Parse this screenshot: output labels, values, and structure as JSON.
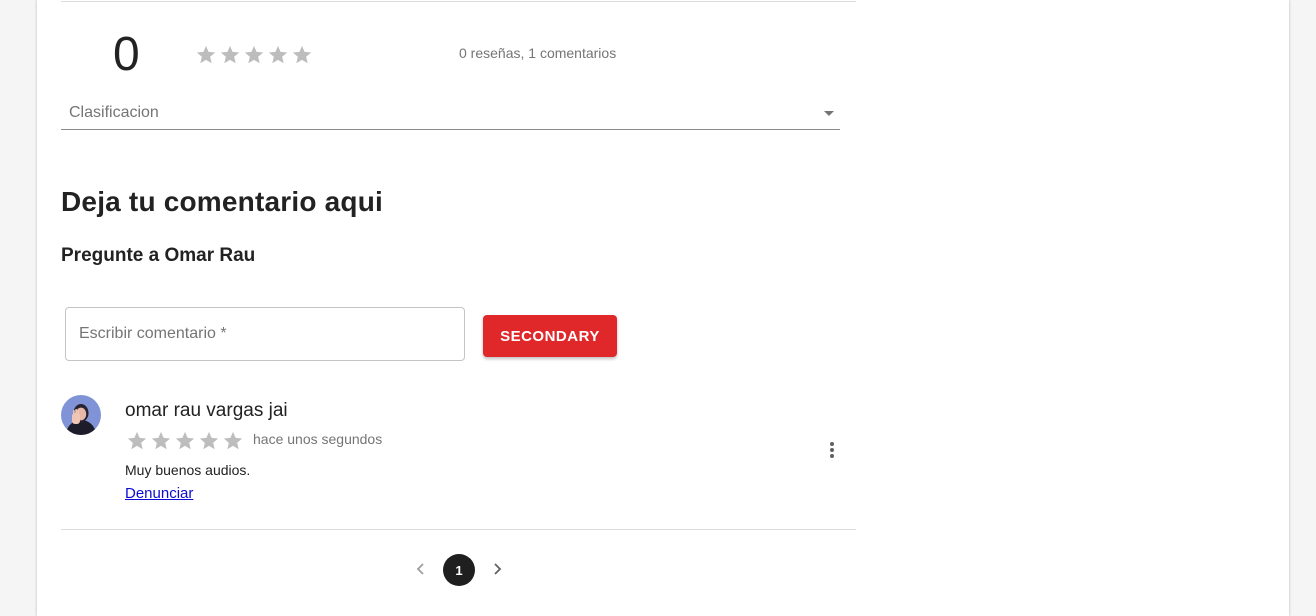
{
  "summary": {
    "average": "0",
    "average_stars": 0,
    "counts_text": "0 reseñas, 1 comentarios",
    "sort_select_label": "Clasificacion"
  },
  "comment_form": {
    "heading": "Deja tu comentario aqui",
    "subheading": "Pregunte a Omar Rau",
    "input_placeholder": "Escribir comentario *",
    "input_value": "",
    "submit_label": "SECONDARY"
  },
  "comments": [
    {
      "author": "omar rau vargas jai",
      "rating": 0,
      "time": "hace unos segundos",
      "text": "Muy buenos audios.",
      "report_label": "Denunciar"
    }
  ],
  "pagination": {
    "current_page": "1"
  },
  "colors": {
    "accent": "#e0282b",
    "star_empty": "#bdbdbd",
    "link": "#0b0bd3",
    "page_active": "#1f1f1f"
  },
  "icons": [
    "star-icon",
    "dropdown-arrow-icon",
    "more-vert-icon",
    "chevron-left-icon",
    "chevron-right-icon",
    "avatar"
  ]
}
